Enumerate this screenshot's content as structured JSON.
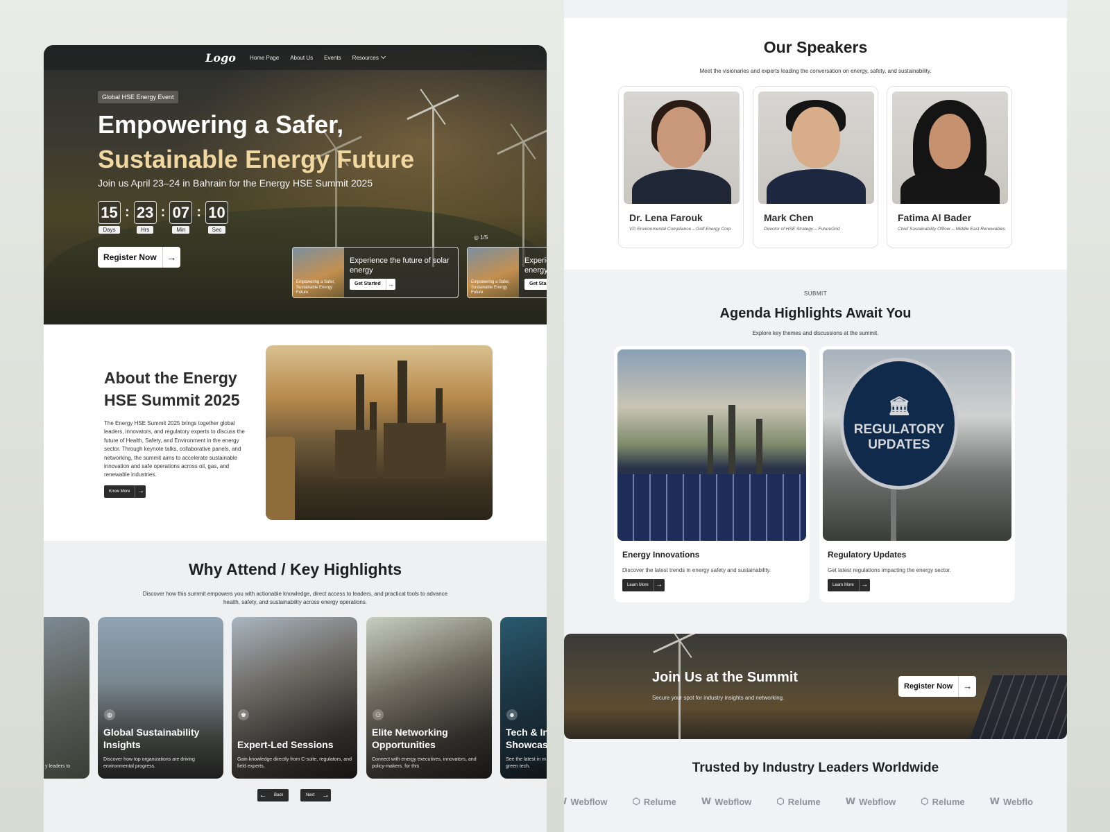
{
  "nav": {
    "logo": "Logo",
    "links": [
      "Home Page",
      "About Us",
      "Events",
      "Resources"
    ]
  },
  "hero": {
    "badge": "Global HSE Energy Event",
    "title_line1": "Empowering a Safer,",
    "title_line2": "Sustainable Energy Future",
    "subtitle": "Join us April 23–24 in Bahrain for the Energy HSE Summit 2025",
    "countdown": [
      {
        "value": "15",
        "label": "Days"
      },
      {
        "value": "23",
        "label": "Hrs"
      },
      {
        "value": "07",
        "label": "Min"
      },
      {
        "value": "10",
        "label": "Sec"
      }
    ],
    "register_label": "Register Now",
    "slide_counter": "1/5",
    "slides": [
      {
        "thumb_text": "Empowering a Safer, Sustainable Energy Future",
        "title": "Experience the future of solar energy",
        "button": "Get Started"
      },
      {
        "thumb_text": "Empowering a Safer, Sustainable Energy Future",
        "title": "Experience the future of solar energy",
        "button": "Get Started"
      }
    ]
  },
  "about": {
    "title": "About the Energy HSE Summit 2025",
    "text": "The Energy HSE Summit 2025 brings together global leaders, innovators, and regulatory experts to discuss the future of Health, Safety, and Environment in the energy sector. Through keynote talks, collaborative panels, and networking, the summit aims to accelerate sustainable innovation and safe operations across oil, gas, and renewable industries.",
    "button": "Know More"
  },
  "why": {
    "title": "Why Attend / Key Highlights",
    "subtitle": "Discover how this summit empowers you with actionable knowledge, direct access to leaders, and practical tools to advance health, safety, and sustainability across energy operations.",
    "partial_left_text": "y leaders to",
    "cards": [
      {
        "title": "Global Sustainability Insights",
        "text": "Discover how top organizations are driving environmental progress.",
        "icon": "globe-icon"
      },
      {
        "title": "Expert-Led Sessions",
        "text": "Gain knowledge directly from C-suite, regulators, and field experts.",
        "icon": "speaker-icon"
      },
      {
        "title": "Elite Networking Opportunities",
        "text": "Connect with energy executives, innovators, and policy-makers. for this",
        "icon": "people-icon"
      },
      {
        "title": "Tech & In Showcas",
        "text": "See the latest in m green tech.",
        "icon": "robot-icon"
      }
    ],
    "back_label": "Back",
    "next_label": "Next"
  },
  "speakers": {
    "title": "Our Speakers",
    "subtitle": "Meet the visionaries and experts leading the conversation on energy, safety, and sustainability.",
    "list": [
      {
        "name": "Dr. Lena Farouk",
        "role": "VP, Environmental Compliance – Gulf Energy Corp"
      },
      {
        "name": "Mark Chen",
        "role": "Director of HSE Strategy – FutureGrid"
      },
      {
        "name": "Fatima Al Bader",
        "role": "Chief Sustainability Officer – Middle East Renewables"
      }
    ]
  },
  "agenda": {
    "label": "SUBMIT",
    "title": "Agenda Highlights Await You",
    "subtitle": "Explore key themes and discussions at the summit.",
    "cards": [
      {
        "title": "Energy Innovations",
        "text": "Discover the latest trends in energy safety and sustainability.",
        "button": "Learn More"
      },
      {
        "title": "Regulatory Updates",
        "text": "Get latest regulations impacting the energy sector.",
        "button": "Learn More",
        "sign_line1": "REGULATORY",
        "sign_line2": "UPDATES"
      }
    ]
  },
  "cta": {
    "title": "Join Us at the Summit",
    "subtitle": "Secure your spot for industry insights and networking.",
    "button": "Register Now"
  },
  "trusted": {
    "title": "Trusted by Industry Leaders Worldwide",
    "logos": [
      "Webflow",
      "Relume",
      "Webflow",
      "Relume",
      "Webflow",
      "Relume",
      "Webflo"
    ]
  }
}
